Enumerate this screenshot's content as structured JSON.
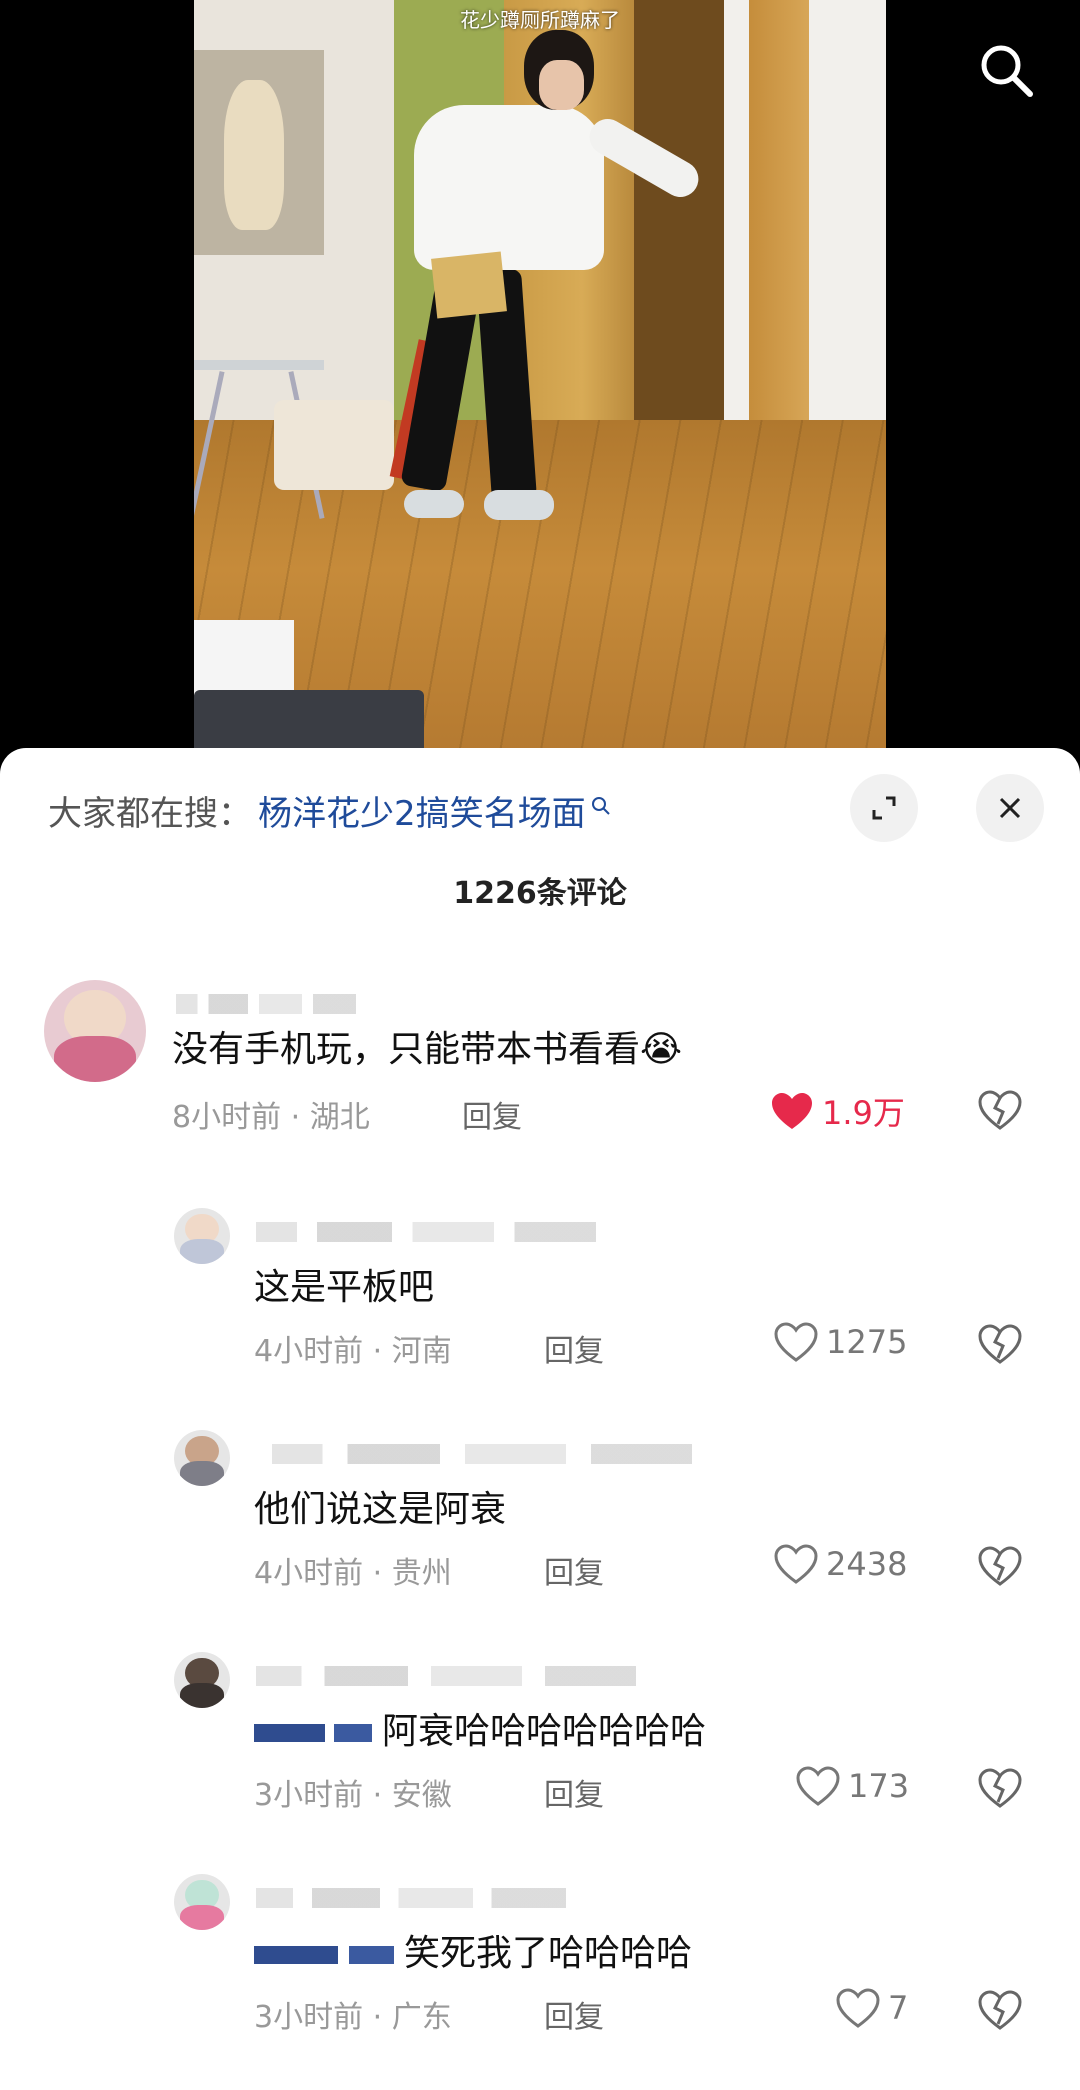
{
  "video": {
    "caption": "花少蹲厕所蹲麻了",
    "search_icon": "search-icon"
  },
  "sheet": {
    "suggest_prefix": "大家都在搜：",
    "suggest_query": "杨洋花少2搞笑名场面",
    "expand_icon": "expand-icon",
    "close_icon": "close-icon",
    "comment_count": "1226条评论"
  },
  "comments": [
    {
      "text": "没有手机玩，只能带本书看看",
      "emoji": "😭",
      "time_location": "8小时前 · 湖北",
      "reply": "回复",
      "likes": "1.9万",
      "liked": true
    },
    {
      "text": "这是平板吧",
      "time_location": "4小时前 · 河南",
      "reply": "回复",
      "likes": "1275",
      "liked": false
    },
    {
      "text": "他们说这是阿衰",
      "time_location": "4小时前 · 贵州",
      "reply": "回复",
      "likes": "2438",
      "liked": false
    },
    {
      "text": "阿衰哈哈哈哈哈哈哈",
      "time_location": "3小时前 · 安徽",
      "reply": "回复",
      "likes": "173",
      "liked": false
    },
    {
      "text": "笑死我了哈哈哈哈",
      "time_location": "3小时前 · 广东",
      "reply": "回复",
      "likes": "7",
      "liked": false
    }
  ],
  "colors": {
    "like_active": "#e6294b",
    "link": "#1f4b9a"
  }
}
